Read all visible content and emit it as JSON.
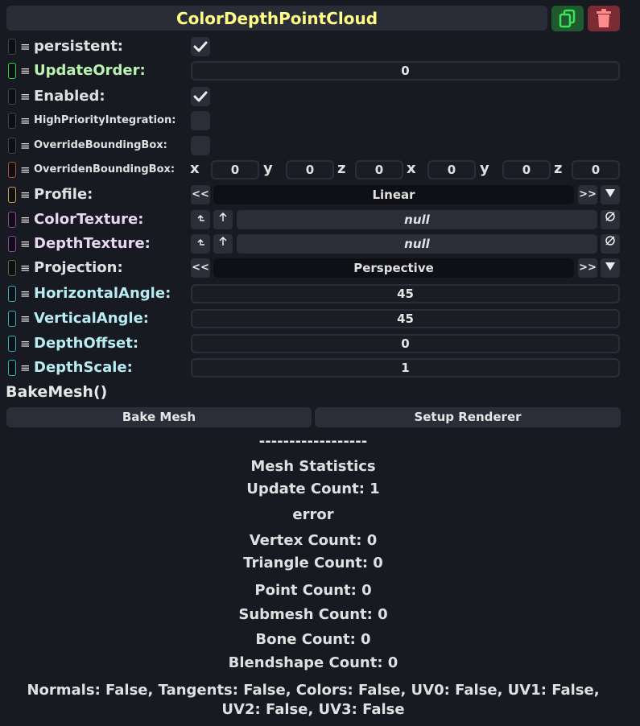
{
  "header": {
    "title": "ColorDepthPointCloud",
    "duplicate_icon": "duplicate-icon",
    "delete_icon": "trash-icon"
  },
  "fields": {
    "persistent": {
      "label": "persistent:",
      "checked": true
    },
    "update_order": {
      "label": "UpdateOrder:",
      "value": "0"
    },
    "enabled": {
      "label": "Enabled:",
      "checked": true
    },
    "high_priority": {
      "label": "HighPriorityIntegration:",
      "checked": false
    },
    "override_bbox": {
      "label": "OverrideBoundingBox:",
      "checked": false
    },
    "overriden_bbox": {
      "label": "OverridenBoundingBox:",
      "axes": [
        "x",
        "y",
        "z",
        "x",
        "y",
        "z"
      ],
      "values": [
        "0",
        "0",
        "0",
        "0",
        "0",
        "0"
      ]
    },
    "profile": {
      "label": "Profile:",
      "value": "Linear",
      "prev": "<<",
      "next": ">>"
    },
    "color_texture": {
      "label": "ColorTexture:",
      "value": "null"
    },
    "depth_texture": {
      "label": "DepthTexture:",
      "value": "null"
    },
    "projection": {
      "label": "Projection:",
      "value": "Perspective",
      "prev": "<<",
      "next": ">>"
    },
    "horizontal_angle": {
      "label": "HorizontalAngle:",
      "value": "45"
    },
    "vertical_angle": {
      "label": "VerticalAngle:",
      "value": "45"
    },
    "depth_offset": {
      "label": "DepthOffset:",
      "value": "0"
    },
    "depth_scale": {
      "label": "DepthScale:",
      "value": "1"
    }
  },
  "actions": {
    "method_label": "BakeMesh()",
    "bake_mesh": "Bake Mesh",
    "setup_renderer": "Setup Renderer"
  },
  "stats": {
    "separator": "------------------",
    "title": "Mesh Statistics",
    "update_count": "Update Count: 1",
    "status": "error",
    "vertex_count": "Vertex Count: 0",
    "triangle_count": "Triangle Count: 0",
    "point_count": "Point Count: 0",
    "submesh_count": "Submesh Count: 0",
    "bone_count": "Bone Count: 0",
    "blendshape_count": "Blendshape Count: 0",
    "attributes": "Normals: False, Tangents: False, Colors: False, UV0: False, UV1: False, UV2: False, UV3: False"
  },
  "colors": {
    "title": "#ffff88",
    "handle_bool": "#444444",
    "handle_int": "#2fd34a",
    "handle_bbox": "#a8552a",
    "handle_enum": "#c9a54a",
    "handle_texture": "#9a3fb5",
    "handle_projection": "#5c6a3a",
    "handle_float": "#2fb7c0"
  }
}
